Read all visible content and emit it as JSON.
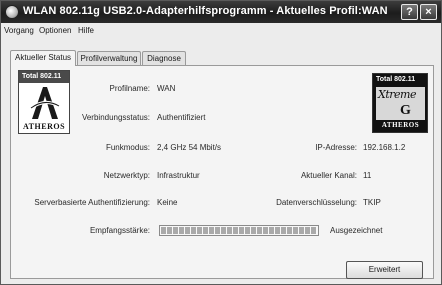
{
  "window": {
    "title": "WLAN 802.11g USB2.0-Adapterhilfsprogramm - Aktuelles Profil:WAN",
    "help_label": "?",
    "close_label": "×"
  },
  "menu": [
    "Vorgang",
    "Optionen",
    "Hilfe"
  ],
  "tabs": [
    {
      "label": "Aktueller Status",
      "active": true
    },
    {
      "label": "Profilverwaltung",
      "active": false
    },
    {
      "label": "Diagnose",
      "active": false
    }
  ],
  "logo_left": {
    "top": "Total 802.11",
    "caption": "ATHEROS"
  },
  "logo_right": {
    "top": "Total 802.11",
    "script": "Xtreme",
    "letter": "G",
    "caption": "ATHEROS"
  },
  "status": {
    "profile_name": {
      "label": "Profilname:",
      "value": "WAN"
    },
    "connection_status": {
      "label": "Verbindungsstatus:",
      "value": "Authentifiziert"
    },
    "radio_mode": {
      "label": "Funkmodus:",
      "value": "2,4 GHz 54 Mbit/s"
    },
    "ip_address": {
      "label": "IP-Adresse:",
      "value": "192.168.1.2"
    },
    "network_type": {
      "label": "Netzwerktyp:",
      "value": "Infrastruktur"
    },
    "current_channel": {
      "label": "Aktueller Kanal:",
      "value": "11"
    },
    "server_auth": {
      "label": "Serverbasierte Authentifizierung:",
      "value": "Keine"
    },
    "data_encryption": {
      "label": "Datenverschlüsselung:",
      "value": "TKIP"
    },
    "signal_strength": {
      "label": "Empfangsstärke:",
      "value": "Ausgezeichnet",
      "level": 1.0
    }
  },
  "buttons": {
    "close": "Erweitert"
  }
}
